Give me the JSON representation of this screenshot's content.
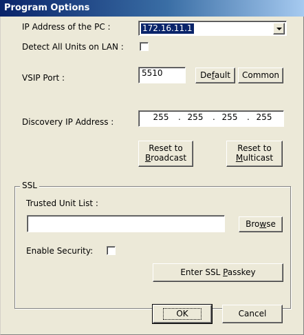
{
  "window": {
    "title": "Program Options"
  },
  "ip_address": {
    "label": "IP Address of the PC :",
    "value": "172.16.11.1"
  },
  "detect_all": {
    "label": "Detect All Units on LAN :",
    "checked": false
  },
  "vsip_port": {
    "label": "VSIP Port :",
    "value": "5510",
    "default_label": "Default",
    "common_label": "Common"
  },
  "discovery_ip": {
    "label": "Discovery IP Address :",
    "octets": [
      "255",
      "255",
      "255",
      "255"
    ],
    "separator": "."
  },
  "reset_broadcast": {
    "line1": "Reset to",
    "line2": "Broadcast"
  },
  "reset_multicast": {
    "line1": "Reset to",
    "line2": "Multicast"
  },
  "ssl": {
    "group_title": "SSL",
    "trusted_label": "Trusted Unit List :",
    "trusted_value": "",
    "browse_label": "Browse",
    "enable_security_label": "Enable Security:",
    "enable_security_checked": false,
    "passkey_label": "Enter SSL Passkey"
  },
  "footer": {
    "ok_label": "OK",
    "cancel_label": "Cancel"
  }
}
